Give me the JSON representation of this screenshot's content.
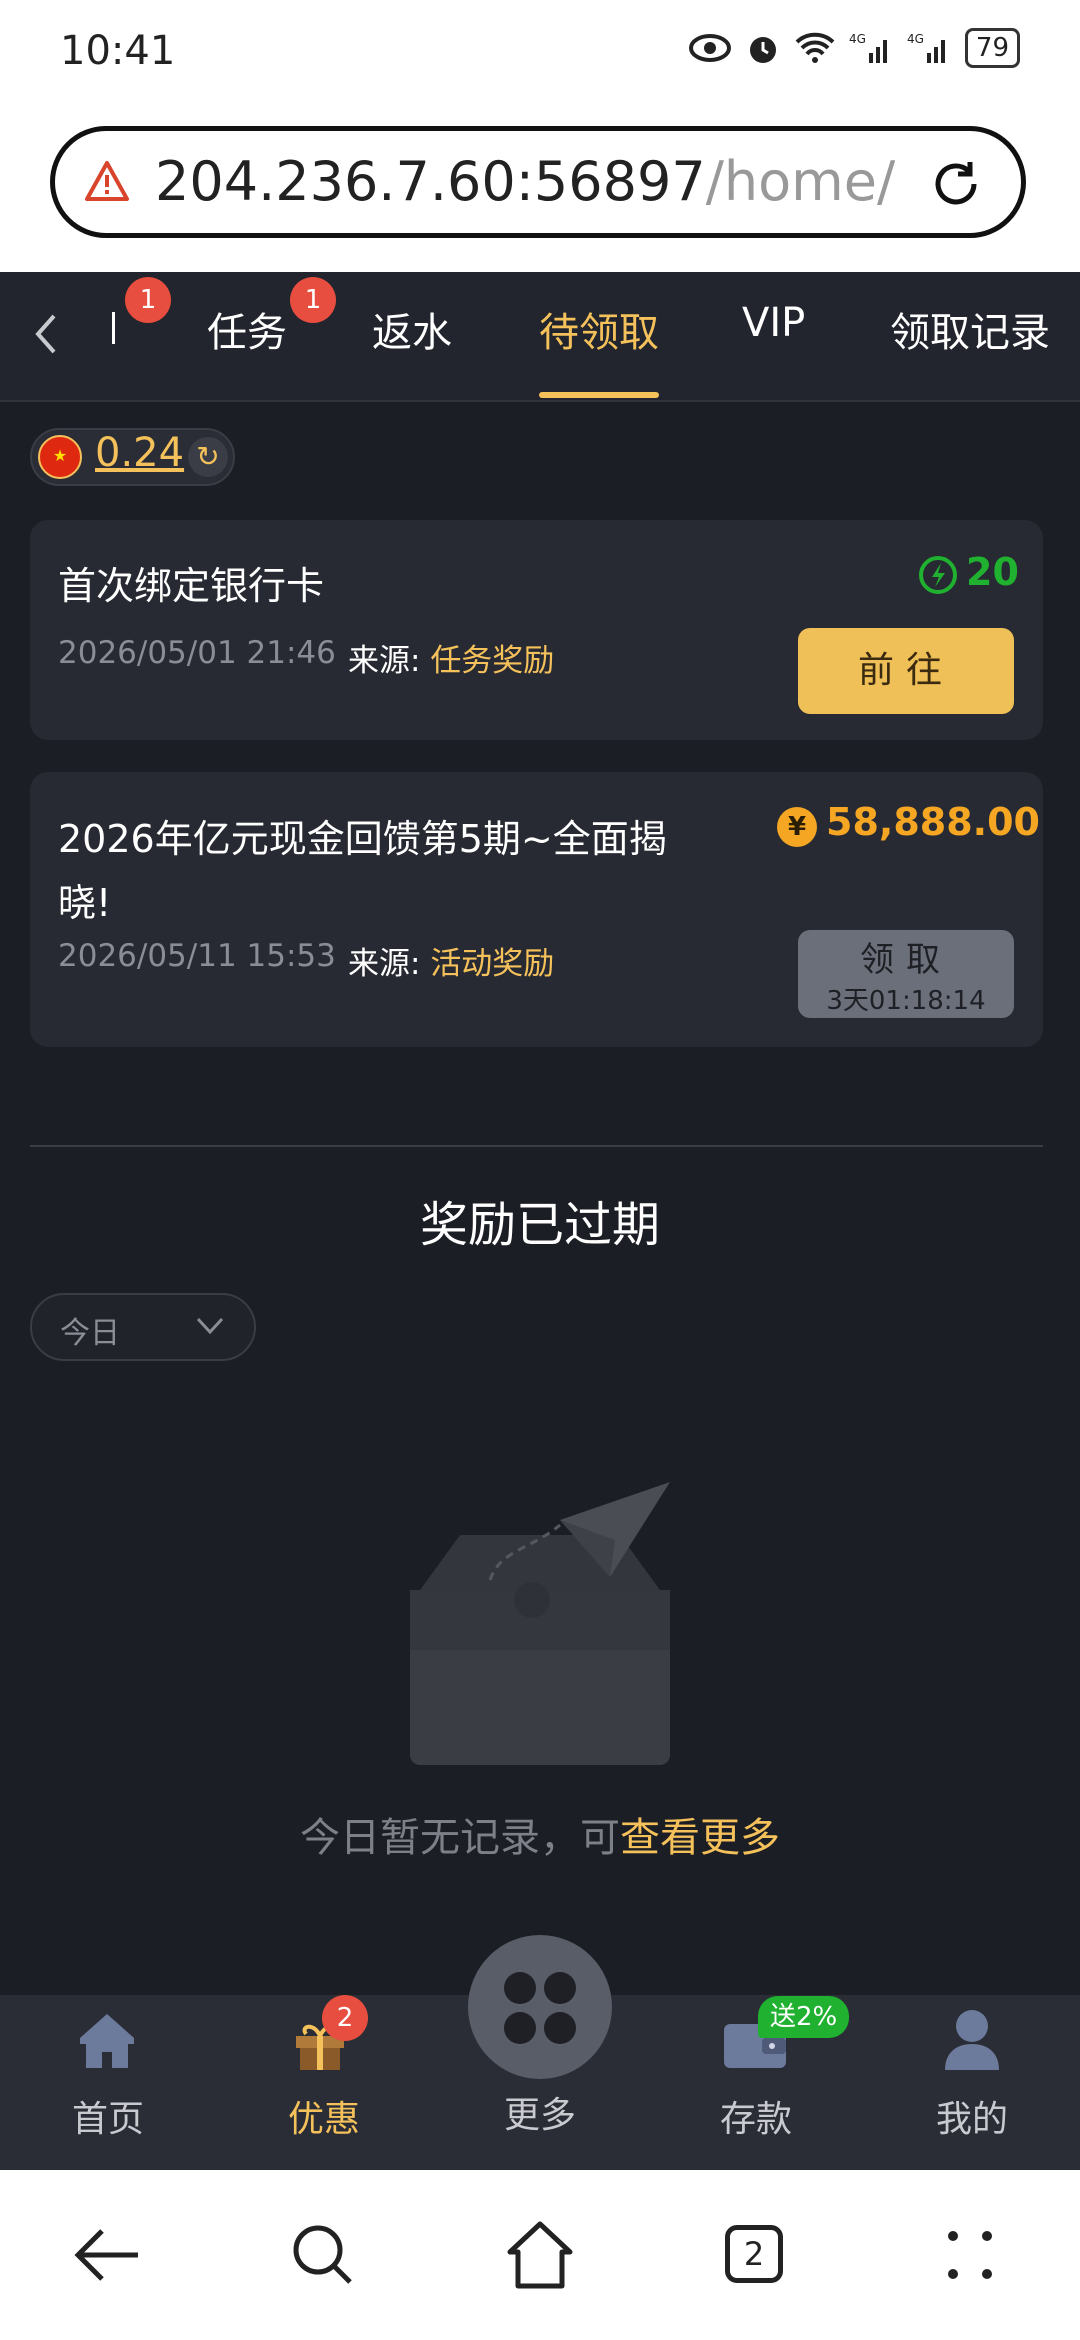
{
  "status_bar": {
    "time": "10:41",
    "battery": "79"
  },
  "browser": {
    "url_host": "204.236.7.60:56897",
    "url_path": "/home/car",
    "tab_count": "2"
  },
  "tabs": {
    "items": [
      {
        "label": "",
        "badge": "1"
      },
      {
        "label": "任务",
        "badge": "1"
      },
      {
        "label": "返水"
      },
      {
        "label": "待领取",
        "active": true
      },
      {
        "label": "VIP"
      },
      {
        "label": "领取记录"
      }
    ]
  },
  "balance": {
    "value": "0.24"
  },
  "rewards": [
    {
      "title": "首次绑定银行卡",
      "amount": "20",
      "date": "2026/05/01 21:46",
      "source_label": "来源:",
      "source": "任务奖励",
      "button": "前往"
    },
    {
      "title_line1": "2026年亿元现金回馈第5期~全面揭",
      "title_line2": "晓!",
      "amount": "58,888.00",
      "date": "2026/05/11 15:53",
      "source_label": "来源:",
      "source": "活动奖励",
      "button": "领取",
      "timer": "3天01:18:14"
    }
  ],
  "expired": {
    "title": "奖励已过期",
    "filter": "今日",
    "empty_text": "今日暂无记录，可",
    "empty_link": "查看更多"
  },
  "bottom_nav": {
    "items": [
      {
        "label": "首页"
      },
      {
        "label": "优惠",
        "badge": "2",
        "active": true
      },
      {
        "label": "更多"
      },
      {
        "label": "存款",
        "badge": "送2%"
      },
      {
        "label": "我的"
      }
    ]
  },
  "colors": {
    "accent": "#f5c15b",
    "bg": "#1c1e25",
    "card": "#272a32",
    "green": "#1fb12f",
    "badge_red": "#e84e3f"
  }
}
